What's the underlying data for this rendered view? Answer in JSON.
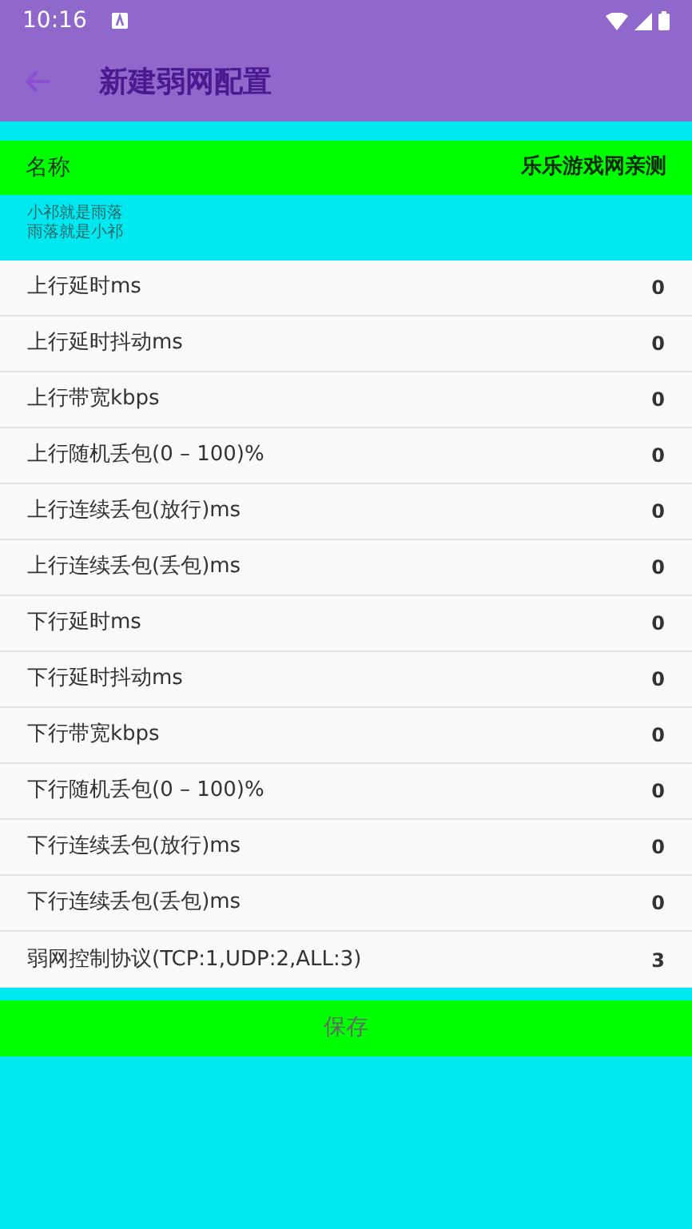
{
  "status_bar": {
    "time": "10:16"
  },
  "app_bar": {
    "title": "新建弱网配置"
  },
  "name_field": {
    "label": "名称",
    "value": "乐乐游戏网亲测"
  },
  "note": [
    "小祁就是雨落",
    "雨落就是小祁"
  ],
  "rows": [
    {
      "label": "上行延时ms",
      "value": "0"
    },
    {
      "label": "上行延时抖动ms",
      "value": "0"
    },
    {
      "label": "上行带宽kbps",
      "value": "0"
    },
    {
      "label": "上行随机丢包(0 – 100)%",
      "value": "0"
    },
    {
      "label": "上行连续丢包(放行)ms",
      "value": "0"
    },
    {
      "label": "上行连续丢包(丢包)ms",
      "value": "0"
    },
    {
      "label": "下行延时ms",
      "value": "0"
    },
    {
      "label": "下行延时抖动ms",
      "value": "0"
    },
    {
      "label": "下行带宽kbps",
      "value": "0"
    },
    {
      "label": "下行随机丢包(0 – 100)%",
      "value": "0"
    },
    {
      "label": "下行连续丢包(放行)ms",
      "value": "0"
    },
    {
      "label": "下行连续丢包(丢包)ms",
      "value": "0"
    },
    {
      "label": "弱网控制协议(TCP:1,UDP:2,ALL:3)",
      "value": "3"
    }
  ],
  "save_button": {
    "label": "保存"
  }
}
